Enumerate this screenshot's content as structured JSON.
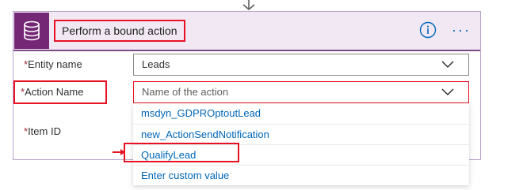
{
  "header": {
    "title": "Perform a bound action",
    "icon": "database-icon",
    "info_icon": "info-icon",
    "more_icon": "more-options-icon"
  },
  "fields": {
    "required_marker": "*",
    "entity": {
      "label": "Entity name",
      "value": "Leads"
    },
    "action": {
      "label": "Action Name",
      "placeholder": "Name of the action"
    },
    "item": {
      "label": "Item ID",
      "value": ""
    }
  },
  "dropdown": {
    "options": [
      "msdyn_GDPROptoutLead",
      "new_ActionSendNotification",
      "QualifyLead",
      "Enter custom value"
    ]
  },
  "colors": {
    "header_bg": "#f1e8f4",
    "app_icon_bg": "#742774",
    "highlight": "#e81123",
    "link": "#0066b8"
  }
}
